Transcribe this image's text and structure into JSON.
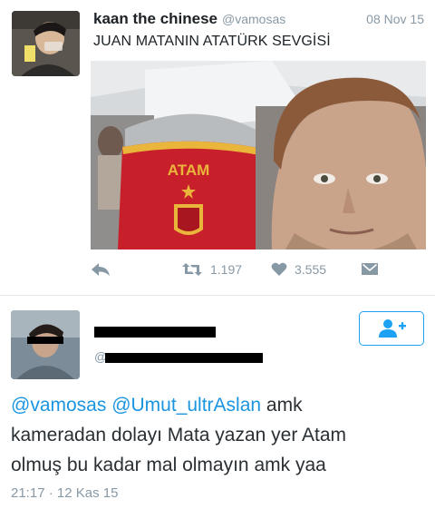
{
  "tweet1": {
    "name": "kaan the chinese",
    "handle": "@vamosas",
    "date": "08 Nov 15",
    "text": "JUAN MATANIN ATATÜRK SEVGİSİ",
    "media": {
      "shirt_text": "ATAM",
      "colors": {
        "shirt_red": "#c8202a",
        "shirt_gold": "#e9b53a"
      }
    },
    "actions": {
      "retweet_count": "1.197",
      "like_count": "3.555"
    }
  },
  "tweet2": {
    "handle_prefix": "@",
    "text": {
      "mention1": "@vamosas",
      "mention2": "@Umut_ultrAslan",
      "line1_rest": " amk",
      "line2": "kameradan dolayı Mata yazan yer Atam",
      "line3": "olmuş bu kadar mal olmayın amk yaa"
    },
    "timestamp": "21:17 · 12 Kas 15"
  },
  "colors": {
    "accent": "#1da1f2",
    "mention": "#1b95e0",
    "muted": "#8899a6"
  }
}
